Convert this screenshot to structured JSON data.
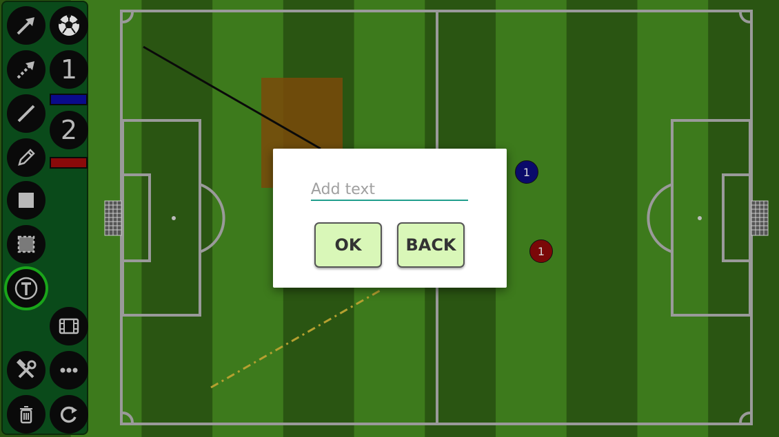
{
  "toolbar": {
    "tools": [
      {
        "name": "arrow-tool",
        "icon": "arrow-icon"
      },
      {
        "name": "ball-tool",
        "icon": "soccer-ball-icon"
      },
      {
        "name": "dashed-arrow-tool",
        "icon": "dashed-arrow-icon"
      },
      {
        "name": "team-one-tool",
        "label": "1"
      },
      {
        "name": "line-tool",
        "icon": "line-icon"
      },
      {
        "name": "team-two-tool",
        "label": "2"
      },
      {
        "name": "pencil-tool",
        "icon": "pencil-icon"
      },
      {
        "name": "rectangle-tool",
        "icon": "filled-square-icon"
      },
      {
        "name": "dashed-rectangle-tool",
        "icon": "dashed-square-icon"
      },
      {
        "name": "text-tool",
        "icon": "text-t-icon",
        "selected": true
      },
      {
        "name": "film-tool",
        "icon": "film-icon"
      },
      {
        "name": "tools-tool",
        "icon": "hammer-wrench-icon"
      },
      {
        "name": "more-tool",
        "icon": "more-dots-icon"
      },
      {
        "name": "delete-tool",
        "icon": "trash-icon"
      },
      {
        "name": "reset-tool",
        "icon": "refresh-icon"
      }
    ],
    "team_one_color": "#0a0a8a",
    "team_two_color": "#8a0a0a"
  },
  "players": [
    {
      "label": "1",
      "team": "blue",
      "color": "#0a0a6a"
    },
    {
      "label": "1",
      "team": "red",
      "color": "#7a0808"
    }
  ],
  "colors": {
    "pitch_dark": "#2a5512",
    "pitch_light": "#3d7a1c",
    "line": "#9a9a9a",
    "highlight_rect": "#7a4a0a",
    "dotted_line": "#b5a030",
    "accent_underline": "#1f9e8c",
    "button_fill": "#d9f7b8"
  },
  "dialog": {
    "placeholder": "Add text",
    "value": "",
    "ok_label": "OK",
    "back_label": "BACK"
  }
}
